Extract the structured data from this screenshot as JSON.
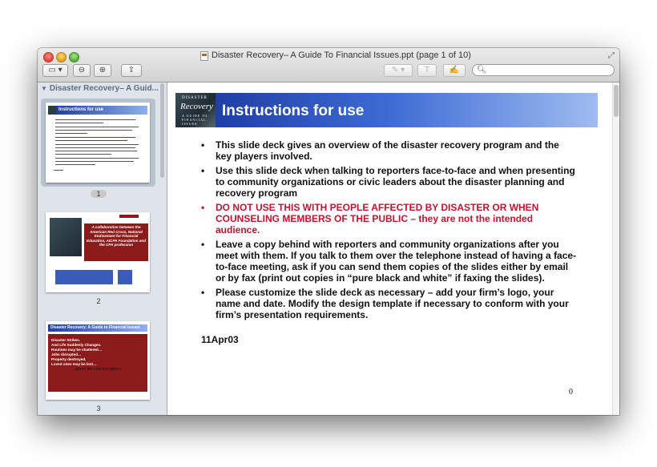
{
  "window": {
    "title": "Disaster Recovery– A Guide To Financial Issues.ppt (page 1 of 10)"
  },
  "toolbar": {
    "view_icon": "sidebar-view-icon",
    "zoom_out_icon": "zoom-out-icon",
    "zoom_in_icon": "zoom-in-icon",
    "share_icon": "share-icon",
    "annotate_icon": "pencil-icon",
    "search_placeholder": ""
  },
  "sidebar": {
    "header": "Disaster Recovery– A Guid...",
    "thumbnails": [
      {
        "page": "1",
        "title": "Instructions for use",
        "selected": true
      },
      {
        "page": "2",
        "title": "",
        "selected": false,
        "text": "A collaboration between the American Red Cross, National Endowment for Financial Education, AICPA Foundation and the CPA profession"
      },
      {
        "page": "3",
        "title": "Disaster Recovery: A Guide to Financial Issues",
        "selected": false,
        "lines": [
          "Disaster Strikes.",
          "And Life Suddenly Changes.",
          "Routines may be shattered…",
          "Jobs disrupted…",
          "Property destroyed.",
          "Loved ones may be lost…",
          "WHAT DO YOU DO NEXT?"
        ]
      }
    ]
  },
  "slide": {
    "logo": {
      "line1": "DISASTER",
      "line2": "Recovery",
      "line3": "A GUIDE TO FINANCIAL ISSUES"
    },
    "title": "Instructions for use",
    "bullets": [
      {
        "text": "This slide deck gives an overview of the disaster recovery program and the key players involved.",
        "red": false
      },
      {
        "text": "Use this slide deck when talking to reporters face-to-face and when presenting to community organizations or civic leaders about the disaster planning and recovery program",
        "red": false
      },
      {
        "text": "DO NOT USE THIS WITH PEOPLE AFFECTED BY DISASTER OR WHEN COUNSELING MEMBERS OF THE PUBLIC – they are not the intended audience.",
        "red": true
      },
      {
        "text": "Leave a copy behind with reporters and community organizations after you meet with them.  If you talk to them over the telephone instead of having a face-to-face meeting, ask if you can send them copies of the slides either by email or by fax (print out copies in “pure black and white” if faxing the slides).",
        "red": false
      },
      {
        "text": "Please customize the slide deck as necessary – add your firm’s logo, your name and date.  Modify the design template if necessary to conform with your firm’s presentation requirements.",
        "red": false
      }
    ],
    "date": "11Apr03",
    "page_number": "0"
  },
  "colors": {
    "banner_dark": "#1f3fa4",
    "banner_light": "#9fbcf0",
    "warning_red": "#c8102e",
    "thumb2_red": "#8b1a1a"
  }
}
